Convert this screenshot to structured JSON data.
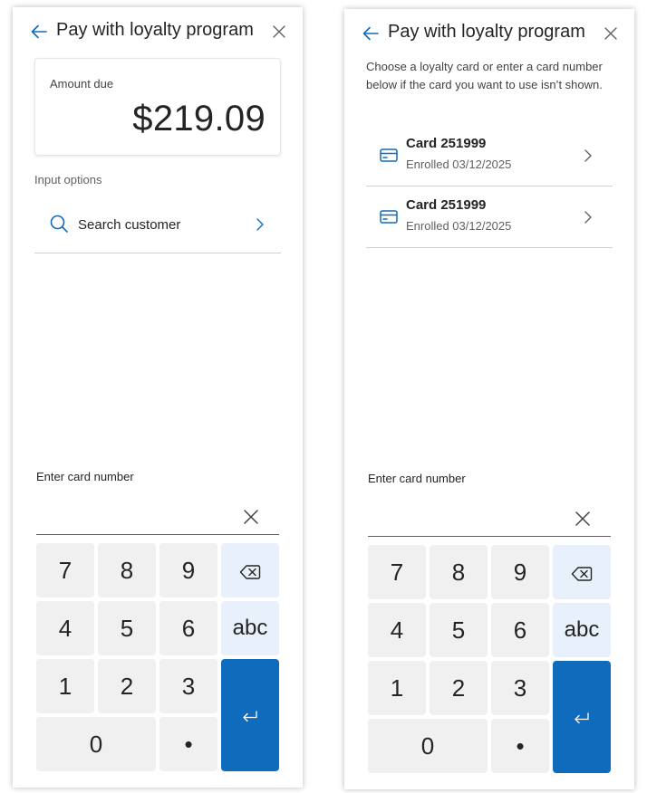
{
  "panels": [
    {
      "header": {
        "title": "Pay with loyalty program",
        "back_icon": "arrow-left-icon",
        "close_icon": "dismiss-icon"
      },
      "amount_due": {
        "label": "Amount due",
        "value": "$219.09"
      },
      "input_options": {
        "label": "Input options",
        "search": {
          "label": "Search customer",
          "icon": "search-icon"
        }
      },
      "entry": {
        "label": "Enter card number",
        "value": "",
        "placeholder": ""
      },
      "keypad": {
        "keys": [
          "7",
          "8",
          "9",
          "4",
          "5",
          "6",
          "1",
          "2",
          "3",
          "0",
          "•"
        ],
        "abc": "abc"
      }
    },
    {
      "header": {
        "title": "Pay with loyalty program",
        "back_icon": "arrow-left-icon",
        "close_icon": "dismiss-icon"
      },
      "intro": "Choose a loyalty card or enter a card number below if the card you want to use isn’t shown.",
      "cards": [
        {
          "name": "Card 251999",
          "enrolled": "Enrolled 03/12/2025"
        },
        {
          "name": "Card 251999",
          "enrolled": "Enrolled 03/12/2025"
        }
      ],
      "entry": {
        "label": "Enter card number",
        "value": "",
        "placeholder": ""
      },
      "keypad": {
        "keys": [
          "7",
          "8",
          "9",
          "4",
          "5",
          "6",
          "1",
          "2",
          "3",
          "0",
          "•"
        ],
        "abc": "abc"
      }
    }
  ],
  "colors": {
    "accent": "#0f6cbd",
    "key_bg": "#f0f0f0",
    "key_fn_bg": "#e8f0fb",
    "divider": "#d1d1d1"
  }
}
